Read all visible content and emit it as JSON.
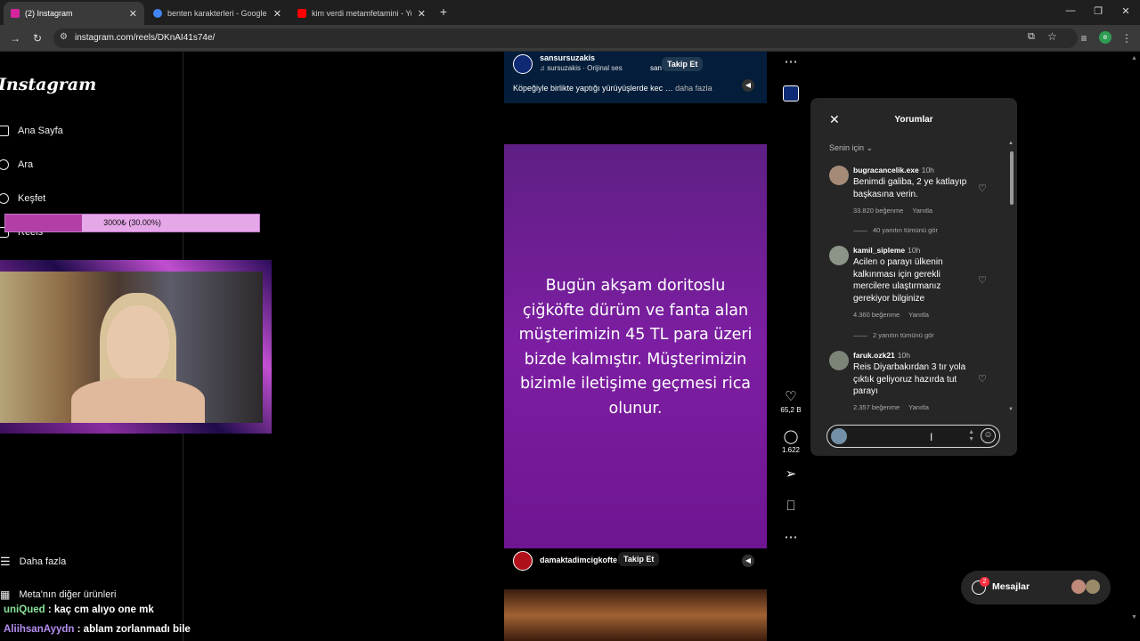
{
  "browser": {
    "tabs": [
      {
        "label": "(2) Instagram",
        "active": true,
        "favicon_color": "#d6249f"
      },
      {
        "label": "benten karakterleri - Google'da",
        "active": false,
        "favicon_color": "#4285f4"
      },
      {
        "label": "kim verdi metamfetamini - You",
        "active": false,
        "favicon_color": "#ff0000"
      }
    ],
    "url": "instagram.com/reels/DKnAI41s74e/",
    "profile_initial": "e"
  },
  "sidebar": {
    "logo": "Instagram",
    "items": [
      {
        "label": "Ana Sayfa"
      },
      {
        "label": "Ara"
      },
      {
        "label": "Keşfet"
      },
      {
        "label": "Reels"
      }
    ],
    "more_label": "Daha fazla",
    "meta_label": "Meta'nın diğer ürünleri"
  },
  "overlay_progress": {
    "text": "3000₺ (30.00%)",
    "fraction": 0.3,
    "fill_color": "#b23fa5",
    "track_color": "#e6a7e9"
  },
  "reel_top": {
    "username": "sansursuzakis",
    "audio": "sursuzakis · Orijinal ses",
    "partial_name": "san",
    "follow": "Takip Et",
    "caption": "Köpeğiyle birlikte yaptığı yürüyüşlerde kec …",
    "more": "daha fazla"
  },
  "reel_main": {
    "text": "Bugün akşam doritoslu çiğköfte dürüm ve fanta alan müşterimizin 45 TL para üzeri bizde kalmıştır. Müşterimizin bizimle iletişime geçmesi rica olunur.",
    "username": "damaktadimcigkofte",
    "follow": "Takip Et"
  },
  "actions": {
    "likes": "65,2 B",
    "comments": "1.622"
  },
  "comments_panel": {
    "title": "Yorumlar",
    "sort": "Senin için",
    "comments": [
      {
        "user": "bugracancelik.exe",
        "time": "10h",
        "text": "Benimdi galiba, 2 ye katlayıp başkasına verin.",
        "likes": "33.820 beğenme",
        "reply": "Yanıtla",
        "replies": "40 yanıtın tümünü gör"
      },
      {
        "user": "kamil_sipleme",
        "time": "10h",
        "text": "Acilen o parayı ülkenin kalkınması için gerekli mercilere ulaştırmanız gerekiyor bilginize",
        "likes": "4.360 beğenme",
        "reply": "Yanıtla",
        "replies": "2 yanıtın tümünü gör"
      },
      {
        "user": "faruk.ozk21",
        "time": "10h",
        "text": "Reis Diyarbakırdan 3 tır yola çıktık geliyoruz hazırda tut parayı",
        "likes": "2.357 beğenme",
        "reply": "Yanıtla"
      }
    ]
  },
  "messages": {
    "label": "Mesajlar",
    "badge": "2"
  },
  "chat": [
    {
      "user": "uniQued",
      "message": ": kaç cm alıyo one mk",
      "color": "#8be39a"
    },
    {
      "user": "AliihsanAyydn",
      "message": ": ablam zorlanmadı bile",
      "color": "#b58ef0"
    }
  ]
}
